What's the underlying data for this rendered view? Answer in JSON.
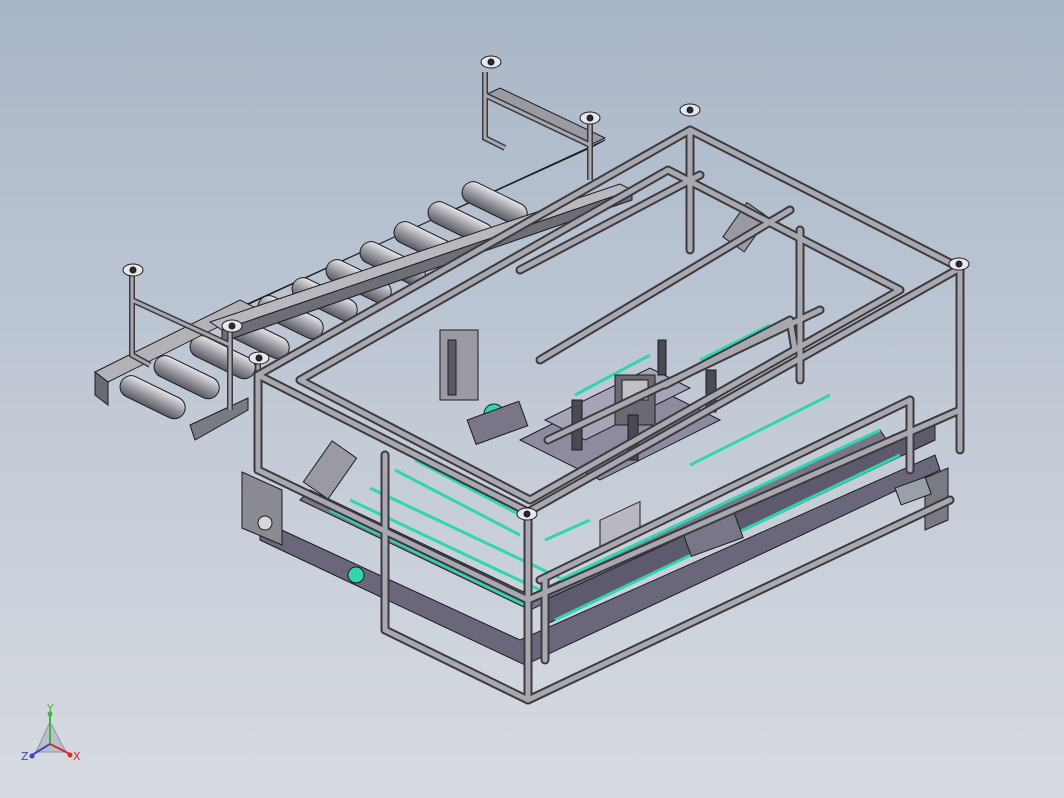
{
  "triad": {
    "x_label": "X",
    "y_label": "Y",
    "z_label": "Z",
    "x_color": "#d42a2a",
    "y_color": "#3fb43f",
    "z_color": "#3a46c8"
  },
  "colors": {
    "viewport_top": "#a9b6c8",
    "viewport_bottom": "#d7dbe1",
    "frame_light": "#a8a8ae",
    "frame_dark": "#55555c",
    "plate": "#6e6a7e",
    "belt_accent": "#2fd6b0",
    "outline": "#1c1c22"
  },
  "icons": {
    "triad": "coordinate-triad-icon",
    "model": "machine-assembly-model"
  }
}
